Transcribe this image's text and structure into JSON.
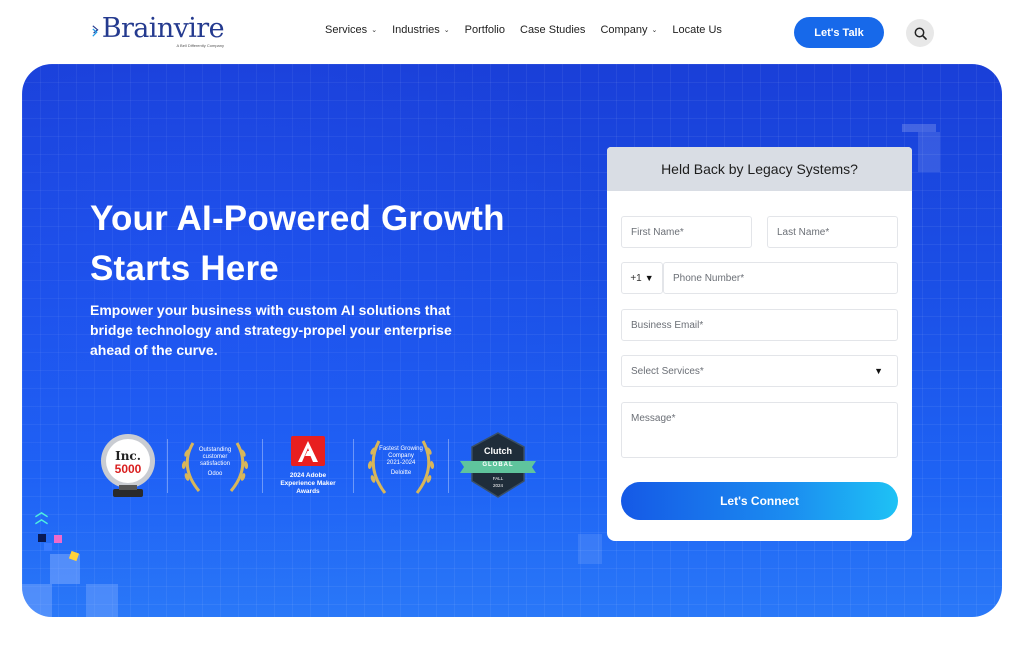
{
  "header": {
    "logo_text": "Brainvire",
    "logo_tagline": "A Bell Differently Company",
    "nav": [
      {
        "label": "Services",
        "dropdown": true
      },
      {
        "label": "Industries",
        "dropdown": true
      },
      {
        "label": "Portfolio",
        "dropdown": false
      },
      {
        "label": "Case Studies",
        "dropdown": false
      },
      {
        "label": "Company",
        "dropdown": true
      },
      {
        "label": "Locate Us",
        "dropdown": false
      }
    ],
    "cta_label": "Let's Talk",
    "search_icon": "search-icon"
  },
  "hero": {
    "headline": "Your AI-Powered Growth Starts Here",
    "subtext": "Empower your business with custom AI solutions that bridge technology and strategy-propel your enterprise ahead of the curve.",
    "awards": {
      "inc": {
        "brand": "Inc.",
        "number": "5000"
      },
      "odoo": {
        "line1": "Outstanding",
        "line2": "customer",
        "line3": "satisfaction",
        "line4": "Odoo"
      },
      "adobe": {
        "line1": "2024 Adobe",
        "line2": "Experience Maker",
        "line3": "Awards"
      },
      "deloitte": {
        "line1": "Fastest Growing",
        "line2": "Company",
        "line3": "2021-2024",
        "line4": "Deloitte"
      },
      "clutch": {
        "brand": "Clutch",
        "ribbon": "GLOBAL",
        "season": "FALL",
        "year": "2024"
      }
    }
  },
  "form": {
    "title": "Held Back by Legacy Systems?",
    "first_name_placeholder": "First Name*",
    "last_name_placeholder": "Last Name*",
    "country_code": "+1",
    "phone_placeholder": "Phone Number*",
    "email_placeholder": "Business Email*",
    "services_placeholder": "Select Services*",
    "message_placeholder": "Message*",
    "submit_label": "Let's Connect"
  },
  "colors": {
    "brand_blue": "#1769ea",
    "hero_blue": "#1b4fe6",
    "logo_navy": "#243a8f"
  }
}
